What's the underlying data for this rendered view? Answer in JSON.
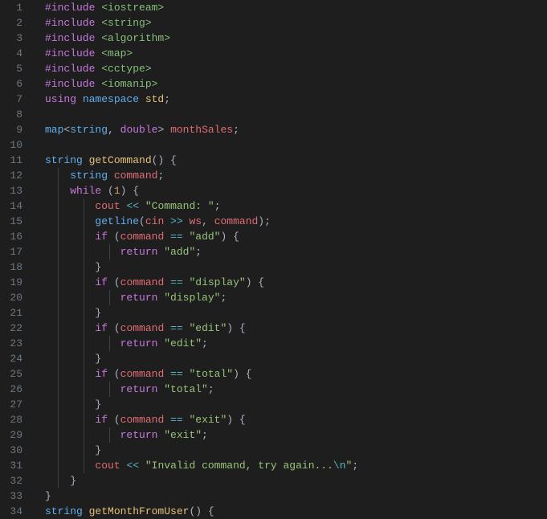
{
  "lineNumbers": [
    "1",
    "2",
    "3",
    "4",
    "5",
    "6",
    "7",
    "8",
    "9",
    "10",
    "11",
    "12",
    "13",
    "14",
    "15",
    "16",
    "17",
    "18",
    "19",
    "20",
    "21",
    "22",
    "23",
    "24",
    "25",
    "26",
    "27",
    "28",
    "29",
    "30",
    "31",
    "32",
    "33",
    "34"
  ],
  "code": {
    "lines": [
      {
        "indent": 0,
        "tokens": [
          {
            "t": "#include ",
            "c": "magenta"
          },
          {
            "t": "<iostream>",
            "c": "green"
          }
        ]
      },
      {
        "indent": 0,
        "tokens": [
          {
            "t": "#include ",
            "c": "magenta"
          },
          {
            "t": "<string>",
            "c": "green"
          }
        ]
      },
      {
        "indent": 0,
        "tokens": [
          {
            "t": "#include ",
            "c": "magenta"
          },
          {
            "t": "<algorithm>",
            "c": "green"
          }
        ]
      },
      {
        "indent": 0,
        "tokens": [
          {
            "t": "#include ",
            "c": "magenta"
          },
          {
            "t": "<map>",
            "c": "green"
          }
        ]
      },
      {
        "indent": 0,
        "tokens": [
          {
            "t": "#include ",
            "c": "magenta"
          },
          {
            "t": "<cctype>",
            "c": "green"
          }
        ]
      },
      {
        "indent": 0,
        "tokens": [
          {
            "t": "#include ",
            "c": "magenta"
          },
          {
            "t": "<iomanip>",
            "c": "green"
          }
        ]
      },
      {
        "indent": 0,
        "tokens": [
          {
            "t": "using ",
            "c": "magenta"
          },
          {
            "t": "namespace ",
            "c": "blue"
          },
          {
            "t": "std",
            "c": "yellow"
          },
          {
            "t": ";",
            "c": "punct"
          }
        ]
      },
      {
        "indent": 0,
        "tokens": []
      },
      {
        "indent": 0,
        "tokens": [
          {
            "t": "map",
            "c": "blue"
          },
          {
            "t": "<",
            "c": "punct"
          },
          {
            "t": "string",
            "c": "blue"
          },
          {
            "t": ", ",
            "c": "punct"
          },
          {
            "t": "double",
            "c": "magenta"
          },
          {
            "t": "> ",
            "c": "punct"
          },
          {
            "t": "monthSales",
            "c": "red"
          },
          {
            "t": ";",
            "c": "punct"
          }
        ]
      },
      {
        "indent": 0,
        "tokens": []
      },
      {
        "indent": 0,
        "tokens": [
          {
            "t": "string ",
            "c": "blue"
          },
          {
            "t": "getCommand",
            "c": "yellow"
          },
          {
            "t": "() {",
            "c": "punct"
          }
        ]
      },
      {
        "indent": 1,
        "tokens": [
          {
            "t": "    ",
            "c": "punct"
          },
          {
            "t": "string ",
            "c": "blue"
          },
          {
            "t": "command",
            "c": "red"
          },
          {
            "t": ";",
            "c": "punct"
          }
        ]
      },
      {
        "indent": 1,
        "tokens": [
          {
            "t": "    ",
            "c": "punct"
          },
          {
            "t": "while ",
            "c": "magenta"
          },
          {
            "t": "(",
            "c": "punct"
          },
          {
            "t": "1",
            "c": "orange"
          },
          {
            "t": ") {",
            "c": "punct"
          }
        ]
      },
      {
        "indent": 2,
        "tokens": [
          {
            "t": "        ",
            "c": "punct"
          },
          {
            "t": "cout",
            "c": "red"
          },
          {
            "t": " << ",
            "c": "cyan"
          },
          {
            "t": "\"Command: \"",
            "c": "string"
          },
          {
            "t": ";",
            "c": "punct"
          }
        ]
      },
      {
        "indent": 2,
        "tokens": [
          {
            "t": "        ",
            "c": "punct"
          },
          {
            "t": "getline",
            "c": "blue"
          },
          {
            "t": "(",
            "c": "punct"
          },
          {
            "t": "cin",
            "c": "red"
          },
          {
            "t": " >> ",
            "c": "cyan"
          },
          {
            "t": "ws",
            "c": "red"
          },
          {
            "t": ", ",
            "c": "punct"
          },
          {
            "t": "command",
            "c": "red"
          },
          {
            "t": ");",
            "c": "punct"
          }
        ]
      },
      {
        "indent": 2,
        "tokens": [
          {
            "t": "        ",
            "c": "punct"
          },
          {
            "t": "if ",
            "c": "magenta"
          },
          {
            "t": "(",
            "c": "punct"
          },
          {
            "t": "command",
            "c": "red"
          },
          {
            "t": " == ",
            "c": "cyan"
          },
          {
            "t": "\"add\"",
            "c": "string"
          },
          {
            "t": ") {",
            "c": "punct"
          }
        ]
      },
      {
        "indent": 3,
        "tokens": [
          {
            "t": "            ",
            "c": "punct"
          },
          {
            "t": "return ",
            "c": "magenta"
          },
          {
            "t": "\"add\"",
            "c": "string"
          },
          {
            "t": ";",
            "c": "punct"
          }
        ]
      },
      {
        "indent": 2,
        "tokens": [
          {
            "t": "        }",
            "c": "punct"
          }
        ]
      },
      {
        "indent": 2,
        "tokens": [
          {
            "t": "        ",
            "c": "punct"
          },
          {
            "t": "if ",
            "c": "magenta"
          },
          {
            "t": "(",
            "c": "punct"
          },
          {
            "t": "command",
            "c": "red"
          },
          {
            "t": " == ",
            "c": "cyan"
          },
          {
            "t": "\"display\"",
            "c": "string"
          },
          {
            "t": ") {",
            "c": "punct"
          }
        ]
      },
      {
        "indent": 3,
        "tokens": [
          {
            "t": "            ",
            "c": "punct"
          },
          {
            "t": "return ",
            "c": "magenta"
          },
          {
            "t": "\"display\"",
            "c": "string"
          },
          {
            "t": ";",
            "c": "punct"
          }
        ]
      },
      {
        "indent": 2,
        "tokens": [
          {
            "t": "        }",
            "c": "punct"
          }
        ]
      },
      {
        "indent": 2,
        "tokens": [
          {
            "t": "        ",
            "c": "punct"
          },
          {
            "t": "if ",
            "c": "magenta"
          },
          {
            "t": "(",
            "c": "punct"
          },
          {
            "t": "command",
            "c": "red"
          },
          {
            "t": " == ",
            "c": "cyan"
          },
          {
            "t": "\"edit\"",
            "c": "string"
          },
          {
            "t": ") {",
            "c": "punct"
          }
        ]
      },
      {
        "indent": 3,
        "tokens": [
          {
            "t": "            ",
            "c": "punct"
          },
          {
            "t": "return ",
            "c": "magenta"
          },
          {
            "t": "\"edit\"",
            "c": "string"
          },
          {
            "t": ";",
            "c": "punct"
          }
        ]
      },
      {
        "indent": 2,
        "tokens": [
          {
            "t": "        }",
            "c": "punct"
          }
        ]
      },
      {
        "indent": 2,
        "tokens": [
          {
            "t": "        ",
            "c": "punct"
          },
          {
            "t": "if ",
            "c": "magenta"
          },
          {
            "t": "(",
            "c": "punct"
          },
          {
            "t": "command",
            "c": "red"
          },
          {
            "t": " == ",
            "c": "cyan"
          },
          {
            "t": "\"total\"",
            "c": "string"
          },
          {
            "t": ") {",
            "c": "punct"
          }
        ]
      },
      {
        "indent": 3,
        "tokens": [
          {
            "t": "            ",
            "c": "punct"
          },
          {
            "t": "return ",
            "c": "magenta"
          },
          {
            "t": "\"total\"",
            "c": "string"
          },
          {
            "t": ";",
            "c": "punct"
          }
        ]
      },
      {
        "indent": 2,
        "tokens": [
          {
            "t": "        }",
            "c": "punct"
          }
        ]
      },
      {
        "indent": 2,
        "tokens": [
          {
            "t": "        ",
            "c": "punct"
          },
          {
            "t": "if ",
            "c": "magenta"
          },
          {
            "t": "(",
            "c": "punct"
          },
          {
            "t": "command",
            "c": "red"
          },
          {
            "t": " == ",
            "c": "cyan"
          },
          {
            "t": "\"exit\"",
            "c": "string"
          },
          {
            "t": ") {",
            "c": "punct"
          }
        ]
      },
      {
        "indent": 3,
        "tokens": [
          {
            "t": "            ",
            "c": "punct"
          },
          {
            "t": "return ",
            "c": "magenta"
          },
          {
            "t": "\"exit\"",
            "c": "string"
          },
          {
            "t": ";",
            "c": "punct"
          }
        ]
      },
      {
        "indent": 2,
        "tokens": [
          {
            "t": "        }",
            "c": "punct"
          }
        ]
      },
      {
        "indent": 2,
        "tokens": [
          {
            "t": "        ",
            "c": "punct"
          },
          {
            "t": "cout",
            "c": "red"
          },
          {
            "t": " << ",
            "c": "cyan"
          },
          {
            "t": "\"Invalid command, try again...",
            "c": "string"
          },
          {
            "t": "\\n",
            "c": "cyan"
          },
          {
            "t": "\"",
            "c": "string"
          },
          {
            "t": ";",
            "c": "punct"
          }
        ]
      },
      {
        "indent": 1,
        "tokens": [
          {
            "t": "    }",
            "c": "punct"
          }
        ]
      },
      {
        "indent": 0,
        "tokens": [
          {
            "t": "}",
            "c": "punct"
          }
        ]
      },
      {
        "indent": 0,
        "tokens": [
          {
            "t": "string ",
            "c": "blue"
          },
          {
            "t": "getMonthFromUser",
            "c": "yellow"
          },
          {
            "t": "() {",
            "c": "punct"
          }
        ]
      }
    ]
  }
}
